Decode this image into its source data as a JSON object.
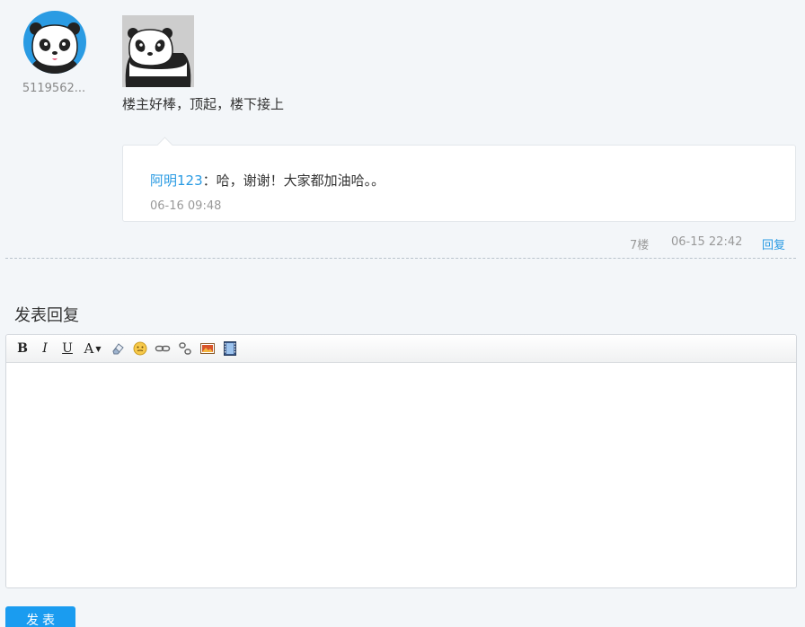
{
  "post": {
    "username": "5119562...",
    "content": "楼主好棒，顶起，楼下接上",
    "floor": "7楼",
    "time": "06-15 22:42",
    "reply_label": "回复"
  },
  "sub_reply": {
    "user": "阿明123",
    "separator": "：",
    "content": "哈，谢谢！大家都加油哈。。",
    "time": "06-16 09:48"
  },
  "reply_form": {
    "title": "发表回复",
    "submit_label": "发表",
    "toolbar": {
      "bold": "B",
      "italic": "I",
      "underline": "U",
      "font_color": "A"
    }
  },
  "colors": {
    "accent": "#2a9be3",
    "submit": "#1a9cf0",
    "background": "#f3f6f9"
  },
  "icons": [
    "panda-avatar-icon",
    "panda-image",
    "eraser-icon",
    "emoji-icon",
    "link-icon",
    "unlink-icon",
    "image-icon",
    "video-icon"
  ]
}
